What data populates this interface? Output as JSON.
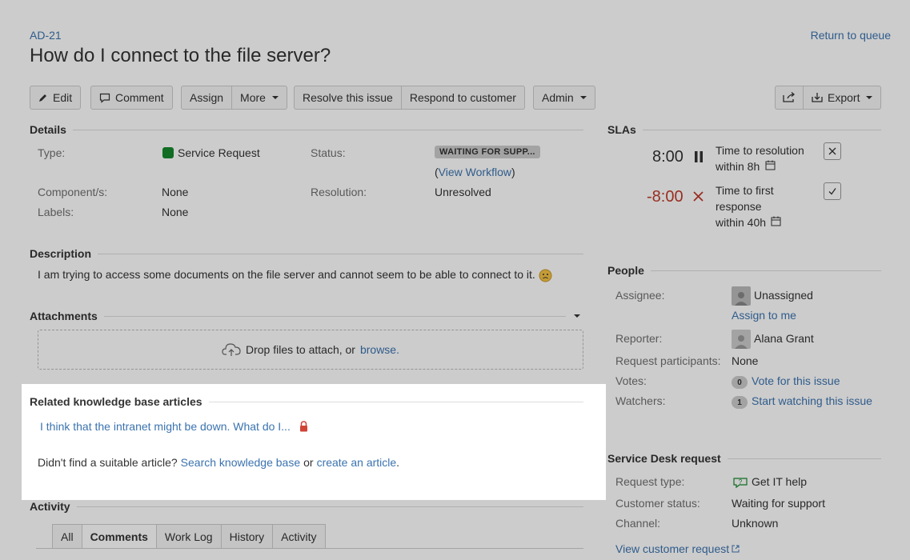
{
  "issue": {
    "key": "AD-21",
    "title": "How do I connect to the file server?",
    "return_label": "Return to queue"
  },
  "toolbar": {
    "edit": "Edit",
    "comment": "Comment",
    "assign": "Assign",
    "more": "More",
    "resolve": "Resolve this issue",
    "respond": "Respond to customer",
    "admin": "Admin",
    "export": "Export"
  },
  "details": {
    "heading": "Details",
    "type_label": "Type:",
    "type_value": "Service Request",
    "status_label": "Status:",
    "status_value": "WAITING FOR SUPP...",
    "view_workflow": "View Workflow",
    "component_label": "Component/s:",
    "component_value": "None",
    "resolution_label": "Resolution:",
    "resolution_value": "Unresolved",
    "labels_label": "Labels:",
    "labels_value": "None"
  },
  "description": {
    "heading": "Description",
    "text": "I am trying to access some documents on the file server and cannot seem to be able to connect to it."
  },
  "attachments": {
    "heading": "Attachments",
    "drop_text": "Drop files to attach, or",
    "browse": "browse."
  },
  "kb": {
    "heading": "Related knowledge base articles",
    "article": "I think that the intranet might be down. What do I...",
    "not_found": "Didn't find a suitable article?",
    "search": "Search knowledge base",
    "or": "or",
    "create": "create an article",
    "period": "."
  },
  "activity": {
    "heading": "Activity",
    "tabs": [
      "All",
      "Comments",
      "Work Log",
      "History",
      "Activity"
    ]
  },
  "slas": {
    "heading": "SLAs",
    "items": [
      {
        "time": "8:00",
        "name": "Time to resolution",
        "target": "within 8h"
      },
      {
        "time": "-8:00",
        "name_line1": "Time to first",
        "name_line2": "response",
        "target": "within 40h"
      }
    ]
  },
  "people": {
    "heading": "People",
    "assignee_label": "Assignee:",
    "assignee_value": "Unassigned",
    "assign_to_me": "Assign to me",
    "reporter_label": "Reporter:",
    "reporter_value": "Alana Grant",
    "participants_label": "Request participants:",
    "participants_value": "None",
    "votes_label": "Votes:",
    "votes_count": "0",
    "vote_link": "Vote for this issue",
    "watchers_label": "Watchers:",
    "watchers_count": "1",
    "watch_link": "Start watching this issue"
  },
  "sd_request": {
    "heading": "Service Desk request",
    "type_label": "Request type:",
    "type_value": "Get IT help",
    "customer_status_label": "Customer status:",
    "customer_status_value": "Waiting for support",
    "channel_label": "Channel:",
    "channel_value": "Unknown",
    "view_link": "View customer request"
  },
  "colors": {
    "link": "#3b73af",
    "overdue": "#c03a2b",
    "lock": "#d04437",
    "type_icon": "#14892c"
  }
}
